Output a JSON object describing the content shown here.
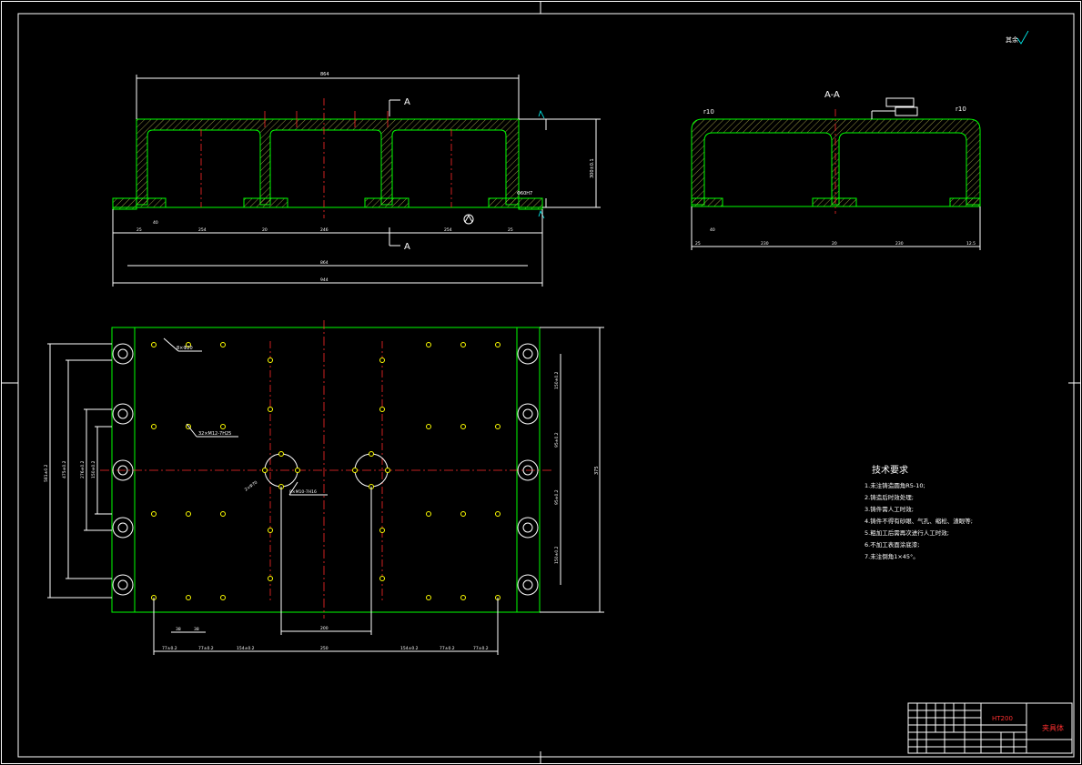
{
  "section_view_label": "A-A",
  "cut_marker_top": "A",
  "cut_marker_bottom": "A",
  "fillet_left": "r10",
  "fillet_right": "r10",
  "roughness_corner": "其余",
  "front_dims": {
    "overall_top": "864",
    "overall_bottom1": "864",
    "overall_bottom2": "944",
    "height": "300±0.1",
    "seg1": "254",
    "seg2": "246",
    "seg3": "254",
    "small_a": "40",
    "small_b": "20",
    "edge_a": "25",
    "edge_b": "25"
  },
  "side_dims": {
    "seg1": "230",
    "seg2": "230",
    "small_a": "40",
    "small_b": "20",
    "edge_a": "25",
    "edge_b": "12.5"
  },
  "plan_dims": {
    "height_right": "375",
    "left_1": "581±0.2",
    "left_2": "475±0.2",
    "left_3": "276±0.2",
    "left_4": "150±0.2",
    "right_1": "150±0.2",
    "right_2": "95±0.2",
    "right_3": "95±0.2",
    "right_4": "150±0.2",
    "bottom_1": "77±0.2",
    "bottom_2": "77±0.2",
    "bottom_3": "154±0.2",
    "bottom_4": "250",
    "bottom_5": "154±0.2",
    "bottom_6": "77±0.2",
    "bottom_7": "77±0.2",
    "inner_1": "38",
    "inner_2": "38",
    "inner_3": "200",
    "callout_1": "8×Φ20",
    "callout_2": "32×M12-7H25",
    "callout_3": "8×M10-7H16",
    "callout_4": "2×Φ70"
  },
  "tech_requirements": {
    "title": "技术要求",
    "items": [
      "1.未注铸造圆角R5-10;",
      "2.铸造后时效处理;",
      "3.铸件需人工时效;",
      "4.铸件不得有砂眼、气孔、缩松、渣眼等;",
      "5.粗加工后需再次进行人工时效;",
      "6.不加工表面涂底漆;",
      "7.未注倒角1×45°。"
    ]
  },
  "title_block": {
    "material": "HT200",
    "part_name": "夹具体"
  }
}
